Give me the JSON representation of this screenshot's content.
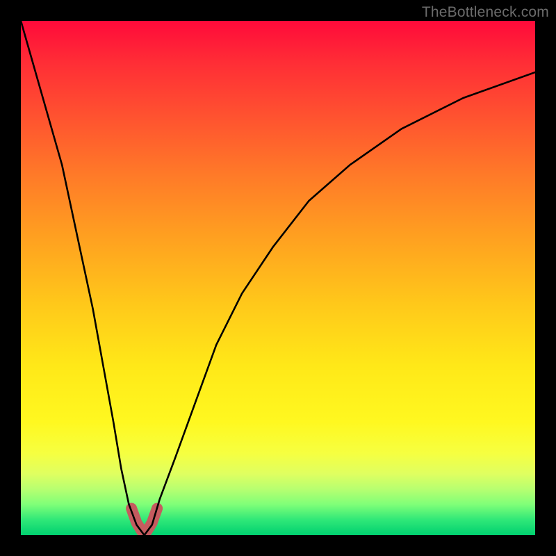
{
  "watermark": "TheBottleneck.com",
  "chart_data": {
    "type": "line",
    "title": "",
    "xlabel": "",
    "ylabel": "",
    "xlim": [
      0,
      100
    ],
    "ylim": [
      0,
      100
    ],
    "grid": false,
    "legend": false,
    "series": [
      {
        "name": "bottleneck-curve",
        "x": [
          0,
          4,
          8,
          11,
          14,
          16,
          18,
          19.5,
          21,
          22.5,
          24,
          25.5,
          27,
          30,
          34,
          38,
          43,
          49,
          56,
          64,
          74,
          86,
          100
        ],
        "values": [
          100,
          86,
          72,
          58,
          44,
          33,
          22,
          13,
          6,
          2,
          0,
          2,
          7,
          15,
          26,
          37,
          47,
          56,
          65,
          72,
          79,
          85,
          90
        ]
      }
    ],
    "annotations": [
      {
        "name": "trough-highlight",
        "color": "#c55b5f",
        "x": [
          21.5,
          22.5,
          23.5,
          24.5,
          25.5,
          26.5
        ],
        "values": [
          5.2,
          2.4,
          0.8,
          0.8,
          2.4,
          5.2
        ]
      }
    ]
  }
}
